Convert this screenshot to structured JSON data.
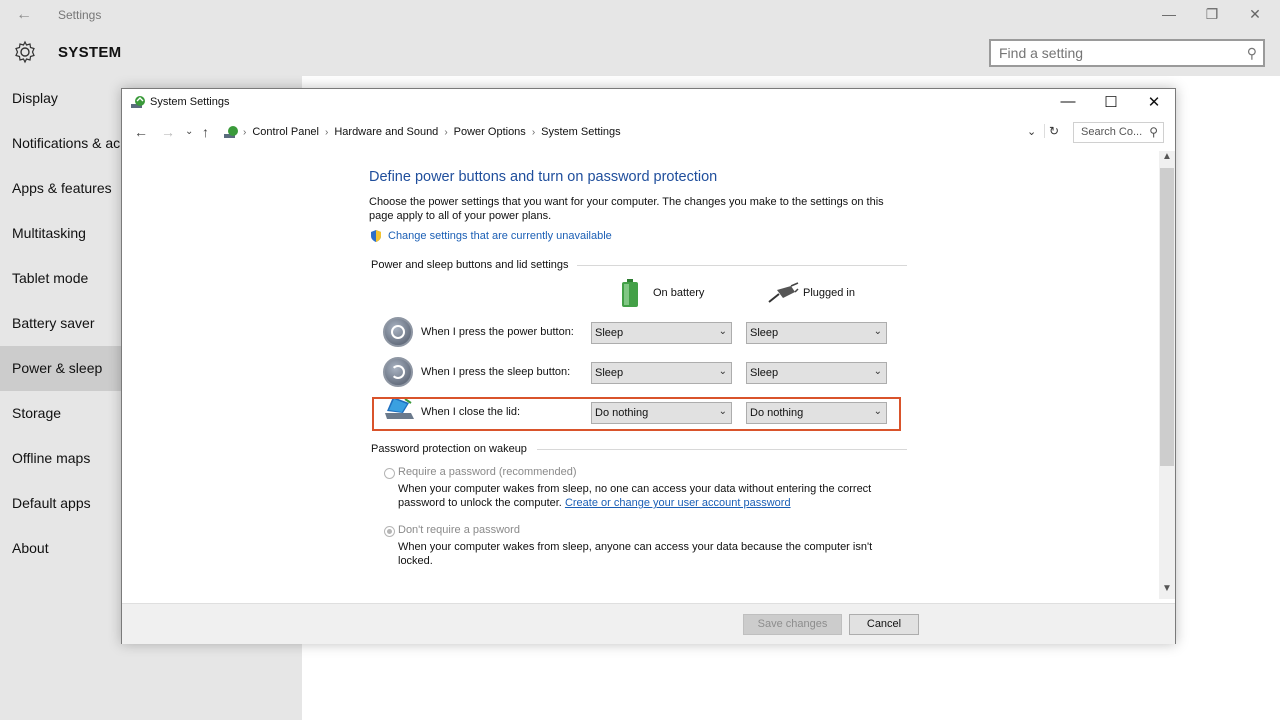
{
  "app": {
    "title": "Settings",
    "section": "SYSTEM",
    "search_placeholder": "Find a setting",
    "controls": {
      "minimize": "—",
      "restore": "❐",
      "close": "✕"
    }
  },
  "sidebar": {
    "items": [
      {
        "label": "Display",
        "active": false
      },
      {
        "label": "Notifications & ac",
        "active": false
      },
      {
        "label": "Apps & features",
        "active": false
      },
      {
        "label": "Multitasking",
        "active": false
      },
      {
        "label": "Tablet mode",
        "active": false
      },
      {
        "label": "Battery saver",
        "active": false
      },
      {
        "label": "Power & sleep",
        "active": true
      },
      {
        "label": "Storage",
        "active": false
      },
      {
        "label": "Offline maps",
        "active": false
      },
      {
        "label": "Default apps",
        "active": false
      },
      {
        "label": "About",
        "active": false
      }
    ]
  },
  "dialog": {
    "title": "System Settings",
    "controls": {
      "minimize": "—",
      "maximize": "☐",
      "close": "✕"
    },
    "breadcrumbs": [
      "Control Panel",
      "Hardware and Sound",
      "Power Options",
      "System Settings"
    ],
    "search_placeholder": "Search Co...",
    "heading": "Define power buttons and turn on password protection",
    "description": "Choose the power settings that you want for your computer. The changes you make to the settings on this page apply to all of your power plans.",
    "change_link": "Change settings that are currently unavailable",
    "buttons_section": {
      "label": "Power and sleep buttons and lid settings",
      "col_battery": "On battery",
      "col_plugged": "Plugged in",
      "rows": [
        {
          "label": "When I press the power button:",
          "battery": "Sleep",
          "plugged": "Sleep"
        },
        {
          "label": "When I press the sleep button:",
          "battery": "Sleep",
          "plugged": "Sleep"
        },
        {
          "label": "When I close the lid:",
          "battery": "Do nothing",
          "plugged": "Do nothing"
        }
      ]
    },
    "password_section": {
      "label": "Password protection on wakeup",
      "option1": {
        "label": "Require a password (recommended)",
        "desc": "When your computer wakes from sleep, no one can access your data without entering the correct password to unlock the computer.",
        "link": "Create or change your user account password",
        "selected": false
      },
      "option2": {
        "label": "Don't require a password",
        "desc": "When your computer wakes from sleep, anyone can access your data because the computer isn't locked.",
        "selected": true
      }
    },
    "footer": {
      "save_label": "Save changes",
      "cancel_label": "Cancel"
    }
  },
  "colors": {
    "accent_link": "#1b5fb5",
    "heading": "#1f4e9c",
    "highlight_border": "#d9532b",
    "sidebar_bg": "#e6e6e6",
    "sidebar_active": "#cccccc"
  }
}
